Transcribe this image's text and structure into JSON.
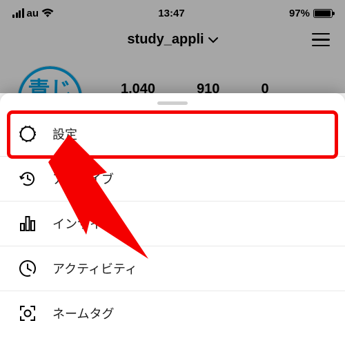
{
  "status_bar": {
    "carrier": "au",
    "time": "13:47",
    "battery_percent": "97%"
  },
  "header": {
    "username": "study_appli"
  },
  "stats": {
    "stat1": "1,040",
    "stat2": "910",
    "stat3": "0"
  },
  "menu": {
    "items": [
      {
        "label": "設定"
      },
      {
        "label": "アーカイブ"
      },
      {
        "label": "インサイト"
      },
      {
        "label": "アクティビティ"
      },
      {
        "label": "ネームタグ"
      }
    ]
  }
}
